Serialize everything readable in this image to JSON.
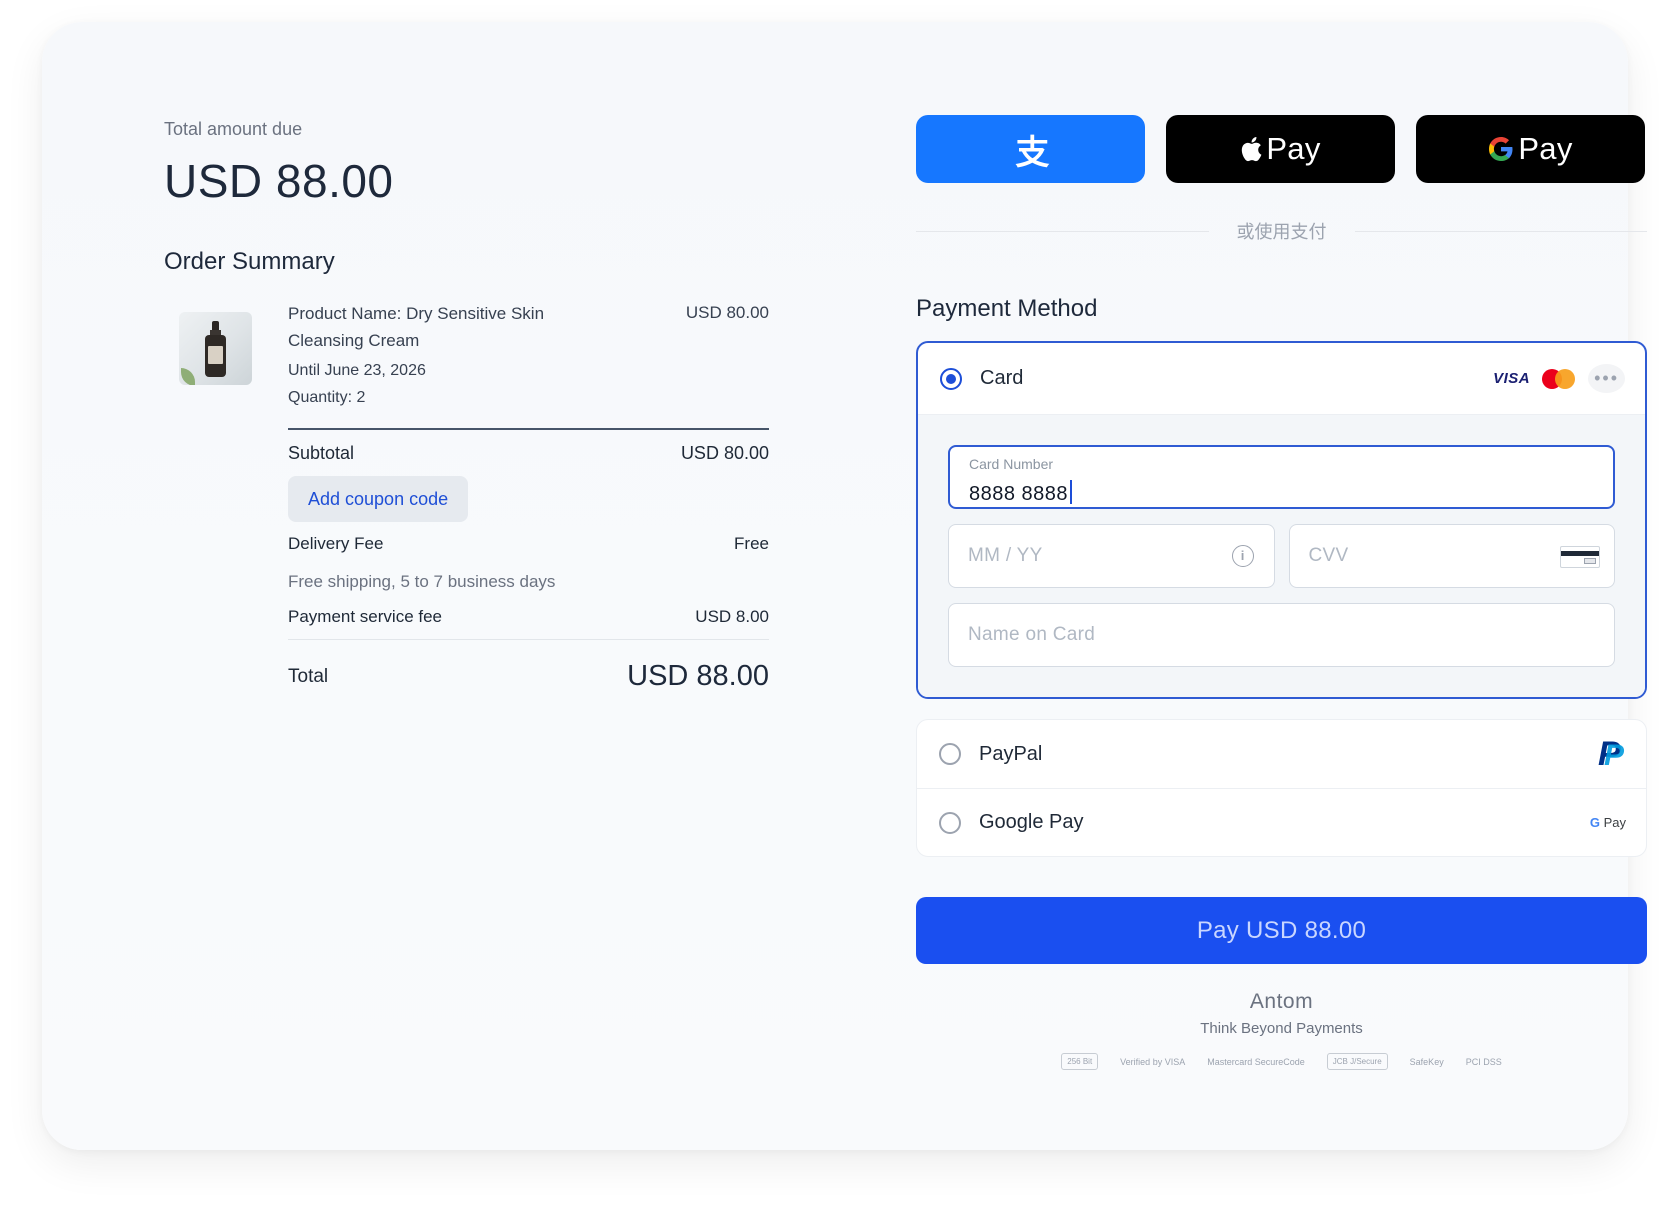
{
  "summary": {
    "amount_label": "Total amount due",
    "amount_value": "USD 88.00",
    "title": "Order Summary",
    "product": {
      "name": "Product Name: Dry Sensitive Skin Cleansing Cream",
      "until": "Until June 23, 2026",
      "quantity": "Quantity: 2",
      "price": "USD 80.00"
    },
    "subtotal_label": "Subtotal",
    "subtotal_value": "USD 80.00",
    "coupon_label": "Add coupon code",
    "delivery_label": "Delivery Fee",
    "delivery_value": "Free",
    "shipping_note": "Free shipping, 5 to 7 business days",
    "service_fee_label": "Payment service fee",
    "service_fee_value": "USD 8.00",
    "total_label": "Total",
    "total_value": "USD 88.00"
  },
  "wallets": {
    "alipay_glyph": "支",
    "apple_text": "Pay",
    "google_g": "G",
    "google_text": "Pay",
    "divider_text": "或使用支付"
  },
  "payment": {
    "title": "Payment Method",
    "card": {
      "label": "Card",
      "selected": true,
      "brand_visa": "VISA",
      "more": "•••",
      "number_label": "Card Number",
      "number_value": "8888 8888",
      "expiry_placeholder": "MM / YY",
      "cvv_placeholder": "CVV",
      "name_placeholder": "Name on Card"
    },
    "paypal_label": "PayPal",
    "paypal_mark": "P",
    "googlepay_label": "Google Pay",
    "googlepay_mark_g": "G",
    "googlepay_mark_text": "Pay",
    "pay_button": "Pay USD 88.00"
  },
  "footer": {
    "brand": "Antom",
    "tagline": "Think Beyond Payments",
    "badges": [
      "256 Bit",
      "Verified by VISA",
      "Mastercard SecureCode",
      "JCB J/Secure",
      "SafeKey",
      "PCI DSS"
    ]
  },
  "colors": {
    "accent": "#1a4ff0",
    "alipay": "#1677ff",
    "selected_border": "#2f5bd3"
  },
  "icons": [
    "alipay-icon",
    "apple-icon",
    "google-icon",
    "info-icon",
    "cvv-card-icon",
    "visa-icon",
    "mastercard-icon",
    "more-icon",
    "paypal-icon",
    "google-pay-icon"
  ]
}
